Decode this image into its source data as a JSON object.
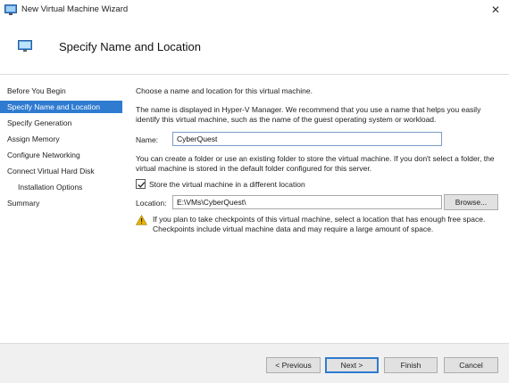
{
  "window": {
    "title": "New Virtual Machine Wizard",
    "close_glyph": "✕"
  },
  "header": {
    "title": "Specify Name and Location",
    "icon": "monitor-icon"
  },
  "sidebar": {
    "items": [
      {
        "label": "Before You Begin",
        "active": false,
        "indent": false
      },
      {
        "label": "Specify Name and Location",
        "active": true,
        "indent": false
      },
      {
        "label": "Specify Generation",
        "active": false,
        "indent": false
      },
      {
        "label": "Assign Memory",
        "active": false,
        "indent": false
      },
      {
        "label": "Configure Networking",
        "active": false,
        "indent": false
      },
      {
        "label": "Connect Virtual Hard Disk",
        "active": false,
        "indent": false
      },
      {
        "label": "Installation Options",
        "active": false,
        "indent": true
      },
      {
        "label": "Summary",
        "active": false,
        "indent": false
      }
    ]
  },
  "main": {
    "intro": "Choose a name and location for this virtual machine.",
    "name_help": "The name is displayed in Hyper-V Manager. We recommend that you use a name that helps you easily identify this virtual machine, such as the name of the guest operating system or workload.",
    "name_label": "Name:",
    "name_value": "CyberQuest",
    "folder_help": "You can create a folder or use an existing folder to store the virtual machine. If you don't select a folder, the virtual machine is stored in the default folder configured for this server.",
    "store_checkbox_label": "Store the virtual machine in a different location",
    "store_checked": true,
    "location_label": "Location:",
    "location_value": "E:\\VMs\\CyberQuest\\",
    "browse_label": "Browse...",
    "warning": "If you plan to take checkpoints of this virtual machine, select a location that has enough free space. Checkpoints include virtual machine data and may require a large amount of space."
  },
  "footer": {
    "previous": "< Previous",
    "next": "Next >",
    "finish": "Finish",
    "cancel": "Cancel"
  },
  "colors": {
    "accent": "#2f7bd0",
    "warning": "#e8b400"
  }
}
